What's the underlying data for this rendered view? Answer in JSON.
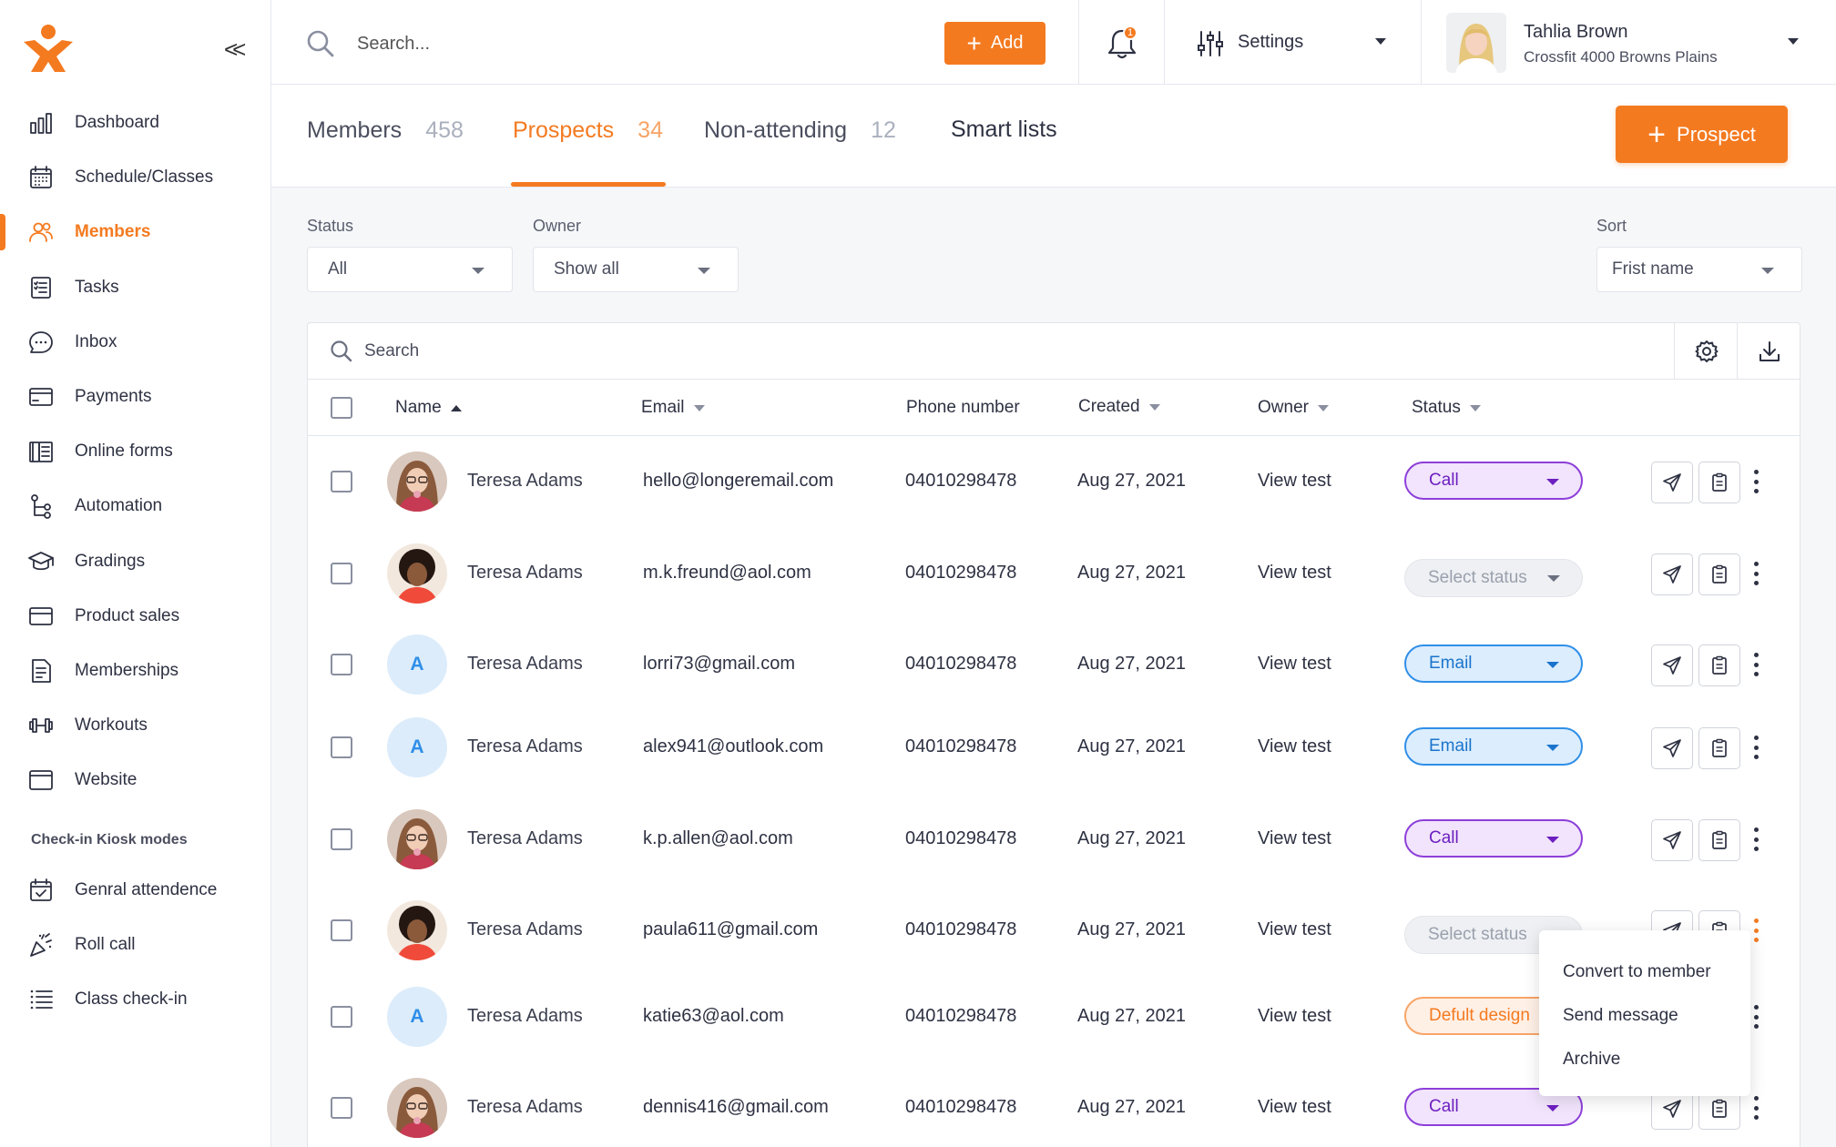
{
  "app": {
    "accent_color": "#f47a20",
    "logo_icon": "person-logo-icon"
  },
  "sidebar": {
    "collapse_label": "<<",
    "items": [
      {
        "label": "Dashboard",
        "icon": "bar-chart-icon",
        "active": false
      },
      {
        "label": "Schedule/Classes",
        "icon": "calendar-icon",
        "active": false
      },
      {
        "label": "Members",
        "icon": "users-icon",
        "active": true
      },
      {
        "label": "Tasks",
        "icon": "checklist-icon",
        "active": false
      },
      {
        "label": "Inbox",
        "icon": "chat-icon",
        "active": false
      },
      {
        "label": "Payments",
        "icon": "credit-card-icon",
        "active": false
      },
      {
        "label": "Online forms",
        "icon": "forms-icon",
        "active": false
      },
      {
        "label": "Automation",
        "icon": "flow-icon",
        "active": false
      },
      {
        "label": "Gradings",
        "icon": "graduation-cap-icon",
        "active": false
      },
      {
        "label": "Product sales",
        "icon": "card-icon",
        "active": false
      },
      {
        "label": "Memberships",
        "icon": "document-icon",
        "active": false
      },
      {
        "label": "Workouts",
        "icon": "dumbbell-icon",
        "active": false
      },
      {
        "label": "Website",
        "icon": "browser-icon",
        "active": false
      }
    ],
    "section_title": "Check-in Kiosk modes",
    "kiosk_items": [
      {
        "label": "Genral attendence",
        "icon": "calendar-check-icon"
      },
      {
        "label": "Roll call",
        "icon": "party-icon"
      },
      {
        "label": "Class check-in",
        "icon": "list-icon"
      }
    ]
  },
  "topbar": {
    "search_placeholder": "Search...",
    "add_label": "Add",
    "notification_count": "1",
    "settings_label": "Settings",
    "user_name": "Tahlia Brown",
    "user_org": "Crossfit 4000 Browns Plains"
  },
  "tabs": [
    {
      "label": "Members",
      "count": "458",
      "active": false
    },
    {
      "label": "Prospects",
      "count": "34",
      "active": true
    },
    {
      "label": "Non-attending",
      "count": "12",
      "active": false
    },
    {
      "label": "Smart lists",
      "count": "",
      "active": false
    }
  ],
  "prospect_button_label": "Prospect",
  "filters": {
    "status": {
      "label": "Status",
      "value": "All"
    },
    "owner": {
      "label": "Owner",
      "value": "Show all"
    },
    "sort": {
      "label": "Sort",
      "value": "Frist name"
    }
  },
  "table": {
    "search_placeholder": "Search",
    "columns": [
      "Name",
      "Email",
      "Phone number",
      "Created",
      "Owner",
      "Status"
    ],
    "rows": [
      {
        "name": "Teresa Adams",
        "avatar": "photo-1",
        "email": "hello@longeremail.com",
        "phone": "04010298478",
        "created": "Aug 27, 2021",
        "owner": "View test",
        "status": "Call",
        "status_type": "call"
      },
      {
        "name": "Teresa Adams",
        "avatar": "photo-2",
        "email": "m.k.freund@aol.com",
        "phone": "04010298478",
        "created": "Aug 27, 2021",
        "owner": "View test",
        "status": "Select status",
        "status_type": "none"
      },
      {
        "name": "Teresa Adams",
        "avatar": "A",
        "email": "lorri73@gmail.com",
        "phone": "04010298478",
        "created": "Aug 27, 2021",
        "owner": "View test",
        "status": "Email",
        "status_type": "email"
      },
      {
        "name": "Teresa Adams",
        "avatar": "A",
        "email": "alex941@outlook.com",
        "phone": "04010298478",
        "created": "Aug 27, 2021",
        "owner": "View test",
        "status": "Email",
        "status_type": "email"
      },
      {
        "name": "Teresa Adams",
        "avatar": "photo-1",
        "email": "k.p.allen@aol.com",
        "phone": "04010298478",
        "created": "Aug 27, 2021",
        "owner": "View test",
        "status": "Call",
        "status_type": "call"
      },
      {
        "name": "Teresa Adams",
        "avatar": "photo-2",
        "email": "paula611@gmail.com",
        "phone": "04010298478",
        "created": "Aug 27, 2021",
        "owner": "View test",
        "status": "Select status",
        "status_type": "none"
      },
      {
        "name": "Teresa Adams",
        "avatar": "A",
        "email": "katie63@aol.com",
        "phone": "04010298478",
        "created": "Aug 27, 2021",
        "owner": "View test",
        "status": "Defult design",
        "status_type": "default"
      },
      {
        "name": "Teresa Adams",
        "avatar": "photo-1",
        "email": "dennis416@gmail.com",
        "phone": "04010298478",
        "created": "Aug 27, 2021",
        "owner": "View test",
        "status": "Call",
        "status_type": "call"
      }
    ]
  },
  "context_menu": {
    "items": [
      "Convert to member",
      "Send message",
      "Archive"
    ]
  }
}
